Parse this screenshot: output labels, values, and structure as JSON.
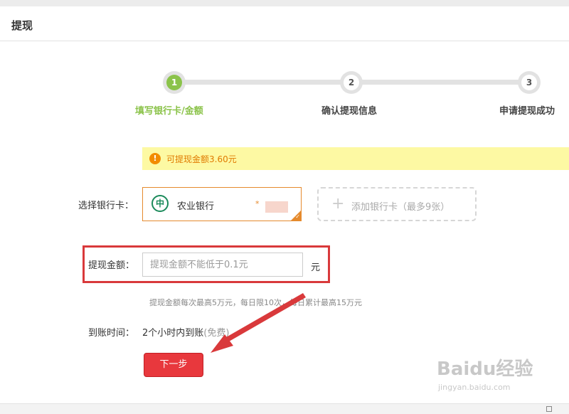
{
  "header": {
    "title": "提现"
  },
  "steps": [
    {
      "number": "1",
      "label": "填写银行卡/金额"
    },
    {
      "number": "2",
      "label": "确认提现信息"
    },
    {
      "number": "3",
      "label": "申请提现成功"
    }
  ],
  "notice": {
    "icon": "warning-icon",
    "text": "可提现金额3.60元"
  },
  "bank": {
    "label": "选择银行卡：",
    "selected": {
      "logo_icon": "abc-bank-logo",
      "name": "农业银行",
      "mask": "*"
    },
    "add_text": "添加银行卡（最多9张）"
  },
  "amount": {
    "label": "提现金额：",
    "placeholder": "提现金额不能低于0.1元",
    "unit": "元",
    "hint": "提现金额每次最高5万元，每日限10次，每日累计最高15万元"
  },
  "arrival": {
    "label": "到账时间：",
    "value": "2个小时内到账",
    "note": "(免费)"
  },
  "next_button": "下一步",
  "watermark": {
    "logo": "Baidu经验",
    "url": "jingyan.baidu.com"
  },
  "colors": {
    "active_step": "#8bc34a",
    "accent": "#e58a2d",
    "button": "#e8383d",
    "annotation": "#d9393b"
  }
}
